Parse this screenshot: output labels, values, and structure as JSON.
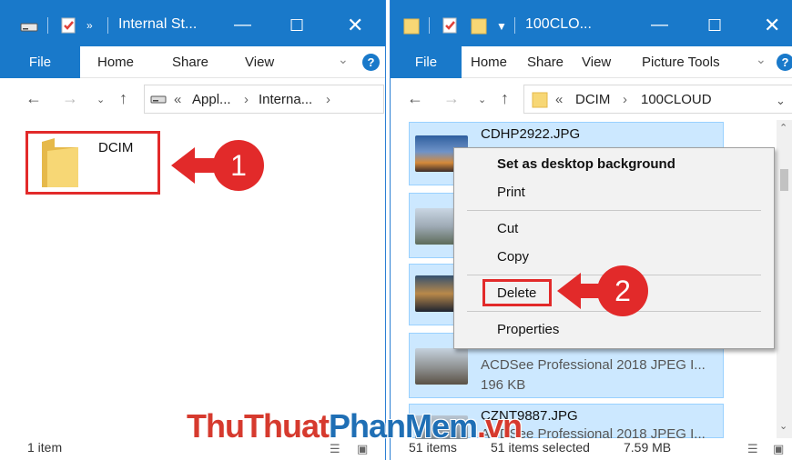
{
  "left": {
    "title": "Internal St...",
    "tabs": {
      "file": "File",
      "home": "Home",
      "share": "Share",
      "view": "View"
    },
    "help": "?",
    "address": {
      "crumb1": "Appl...",
      "crumb2": "Interna..."
    },
    "folder": "DCIM",
    "status": "1 item",
    "step": "1"
  },
  "right": {
    "title": "100CLO...",
    "tabs": {
      "file": "File",
      "home": "Home",
      "share": "Share",
      "view": "View",
      "picture_tools": "Picture Tools"
    },
    "help": "?",
    "address": {
      "crumb1": "DCIM",
      "crumb2": "100CLOUD"
    },
    "files": [
      {
        "name": "CDHP2922.JPG"
      },
      {
        "name": "",
        "type": "ACDSee Professional 2018 JPEG I...",
        "size": "196 KB"
      },
      {
        "name": "CZNT9887.JPG",
        "type": "ACDSee Professional 2018 JPEG I..."
      }
    ],
    "status": {
      "count": "51 items",
      "selected": "51 items selected",
      "size": "7.59 MB"
    },
    "step": "2"
  },
  "context_menu": {
    "set_bg": "Set as desktop background",
    "print": "Print",
    "cut": "Cut",
    "copy": "Copy",
    "delete": "Delete",
    "properties": "Properties"
  },
  "watermark": {
    "part1": "ThuThuat",
    "part2": "PhanMem",
    "part3": ".vn"
  },
  "colors": {
    "accent": "#1979ca",
    "highlight": "#e22a2a",
    "selection": "#cce8ff"
  }
}
